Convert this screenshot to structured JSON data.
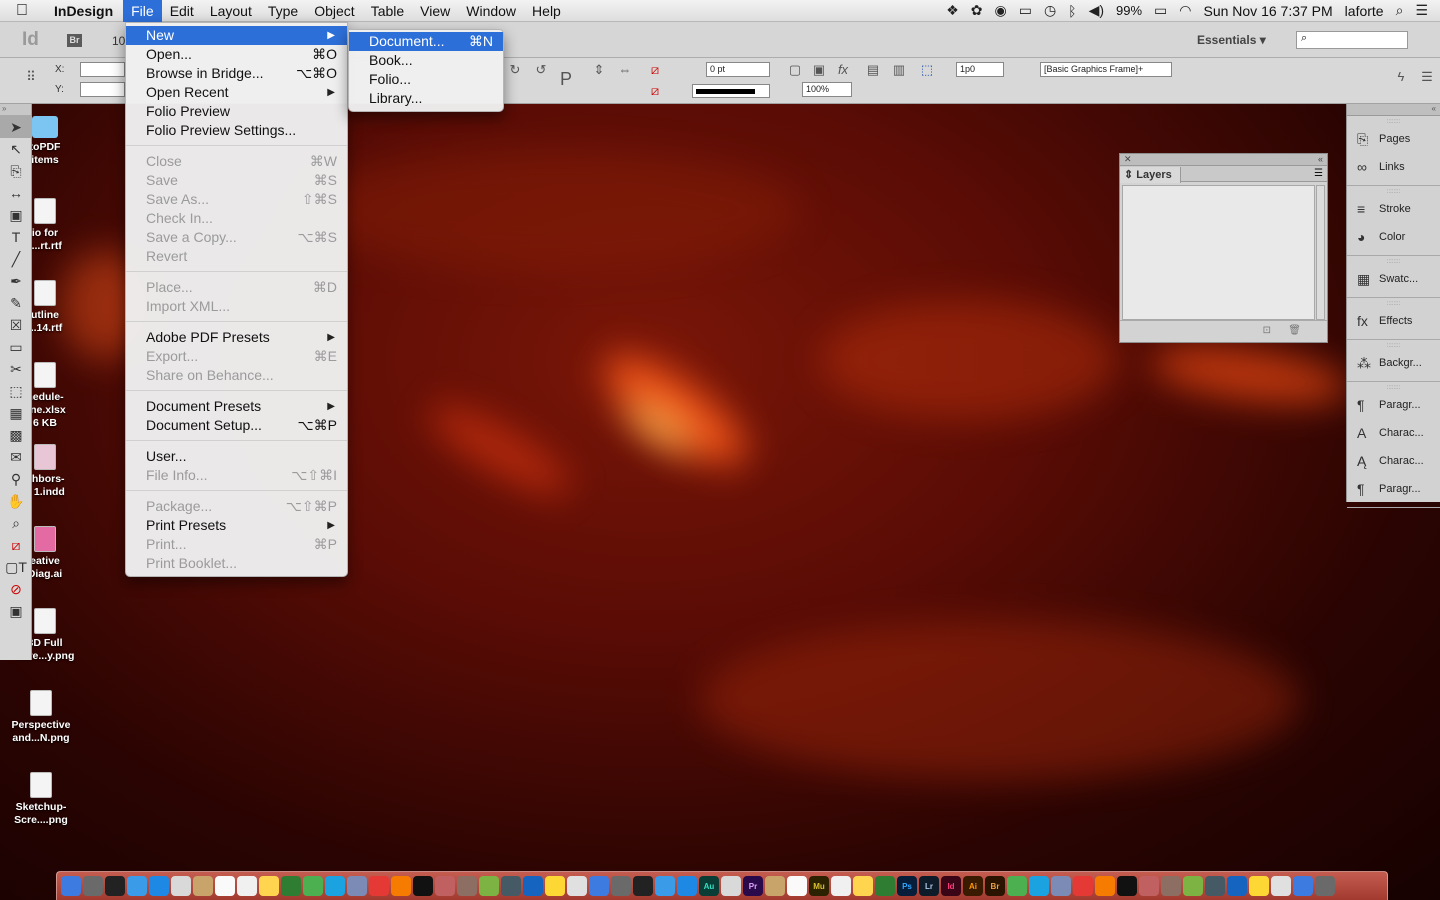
{
  "menubar": {
    "app_name": "InDesign",
    "items": [
      "File",
      "Edit",
      "Layout",
      "Type",
      "Object",
      "Table",
      "View",
      "Window",
      "Help"
    ],
    "status": {
      "battery": "99%",
      "datetime": "Sun Nov 16  7:37 PM",
      "user": "laforte"
    }
  },
  "appbar": {
    "logo": "Id",
    "bridge": "Br",
    "zoom": "10",
    "workspace": "Essentials",
    "search_placeholder": ""
  },
  "control_panel": {
    "x_label": "X:",
    "y_label": "Y:",
    "stroke_weight": "0 pt",
    "opacity": "100%",
    "frame_gap": "1p0",
    "object_style": "[Basic Graphics Frame]+"
  },
  "file_menu": {
    "groups": [
      [
        {
          "label": "New",
          "shortcut": "",
          "submenu": true,
          "disabled": false,
          "highlighted": true
        },
        {
          "label": "Open...",
          "shortcut": "⌘O",
          "submenu": false,
          "disabled": false
        },
        {
          "label": "Browse in Bridge...",
          "shortcut": "⌥⌘O",
          "submenu": false,
          "disabled": false
        },
        {
          "label": "Open Recent",
          "shortcut": "",
          "submenu": true,
          "disabled": false
        },
        {
          "label": "Folio Preview",
          "shortcut": "",
          "submenu": false,
          "disabled": false
        },
        {
          "label": "Folio Preview Settings...",
          "shortcut": "",
          "submenu": false,
          "disabled": false
        }
      ],
      [
        {
          "label": "Close",
          "shortcut": "⌘W",
          "submenu": false,
          "disabled": true
        },
        {
          "label": "Save",
          "shortcut": "⌘S",
          "submenu": false,
          "disabled": true
        },
        {
          "label": "Save As...",
          "shortcut": "⇧⌘S",
          "submenu": false,
          "disabled": true
        },
        {
          "label": "Check In...",
          "shortcut": "",
          "submenu": false,
          "disabled": true
        },
        {
          "label": "Save a Copy...",
          "shortcut": "⌥⌘S",
          "submenu": false,
          "disabled": true
        },
        {
          "label": "Revert",
          "shortcut": "",
          "submenu": false,
          "disabled": true
        }
      ],
      [
        {
          "label": "Place...",
          "shortcut": "⌘D",
          "submenu": false,
          "disabled": true
        },
        {
          "label": "Import XML...",
          "shortcut": "",
          "submenu": false,
          "disabled": true
        }
      ],
      [
        {
          "label": "Adobe PDF Presets",
          "shortcut": "",
          "submenu": true,
          "disabled": false
        },
        {
          "label": "Export...",
          "shortcut": "⌘E",
          "submenu": false,
          "disabled": true
        },
        {
          "label": "Share on Behance...",
          "shortcut": "",
          "submenu": false,
          "disabled": true
        }
      ],
      [
        {
          "label": "Document Presets",
          "shortcut": "",
          "submenu": true,
          "disabled": false
        },
        {
          "label": "Document Setup...",
          "shortcut": "⌥⌘P",
          "submenu": false,
          "disabled": false
        }
      ],
      [
        {
          "label": "User...",
          "shortcut": "",
          "submenu": false,
          "disabled": false
        },
        {
          "label": "File Info...",
          "shortcut": "⌥⇧⌘I",
          "submenu": false,
          "disabled": true
        }
      ],
      [
        {
          "label": "Package...",
          "shortcut": "⌥⇧⌘P",
          "submenu": false,
          "disabled": true
        },
        {
          "label": "Print Presets",
          "shortcut": "",
          "submenu": true,
          "disabled": false
        },
        {
          "label": "Print...",
          "shortcut": "⌘P",
          "submenu": false,
          "disabled": true
        },
        {
          "label": "Print Booklet...",
          "shortcut": "",
          "submenu": false,
          "disabled": true
        }
      ]
    ]
  },
  "new_submenu": [
    {
      "label": "Document...",
      "shortcut": "⌘N",
      "highlighted": true
    },
    {
      "label": "Book...",
      "shortcut": ""
    },
    {
      "label": "Folio...",
      "shortcut": ""
    },
    {
      "label": "Library...",
      "shortcut": ""
    }
  ],
  "layers_panel": {
    "title": "Layers"
  },
  "right_dock": {
    "groups": [
      [
        {
          "label": "Pages",
          "icon": "pages-icon"
        },
        {
          "label": "Links",
          "icon": "links-icon"
        }
      ],
      [
        {
          "label": "Stroke",
          "icon": "stroke-icon"
        },
        {
          "label": "Color",
          "icon": "color-icon"
        }
      ],
      [
        {
          "label": "Swatc...",
          "icon": "swatches-icon"
        }
      ],
      [
        {
          "label": "Effects",
          "icon": "effects-icon"
        }
      ],
      [
        {
          "label": "Backgr...",
          "icon": "background-icon"
        }
      ],
      [
        {
          "label": "Paragr...",
          "icon": "paragraph-icon"
        },
        {
          "label": "Charac...",
          "icon": "character-icon"
        },
        {
          "label": "Charac...",
          "icon": "character-styles-icon"
        },
        {
          "label": "Paragr...",
          "icon": "paragraph-styles-icon"
        }
      ]
    ]
  },
  "desktop_items": [
    {
      "label": "toPDF\nitems",
      "kind": "folder"
    },
    {
      "label": "io for\nt...rt.rtf",
      "kind": "file"
    },
    {
      "label": "utline\n...14.rtf",
      "kind": "file"
    },
    {
      "label": "hedule-\nline.xlsx\n6 KB",
      "kind": "file"
    },
    {
      "label": "ghbors-\ne 1.indd",
      "kind": "file"
    },
    {
      "label": "eative\nDiag.ai",
      "kind": "file"
    },
    {
      "label": "3D Full\nScre...y.png",
      "kind": "file"
    },
    {
      "label": "Perspective\nand...N.png",
      "kind": "file"
    },
    {
      "label": "Sketchup-\nScre....png",
      "kind": "file"
    }
  ],
  "dock_labels": [
    "Au",
    "Pr",
    "Mu",
    "Ps",
    "Lr",
    "Id",
    "Ai",
    "Br"
  ],
  "colors": {
    "menu_highlight": "#2d6fd8",
    "wallpaper": "#7a1608",
    "dock": "#b34a3e"
  }
}
